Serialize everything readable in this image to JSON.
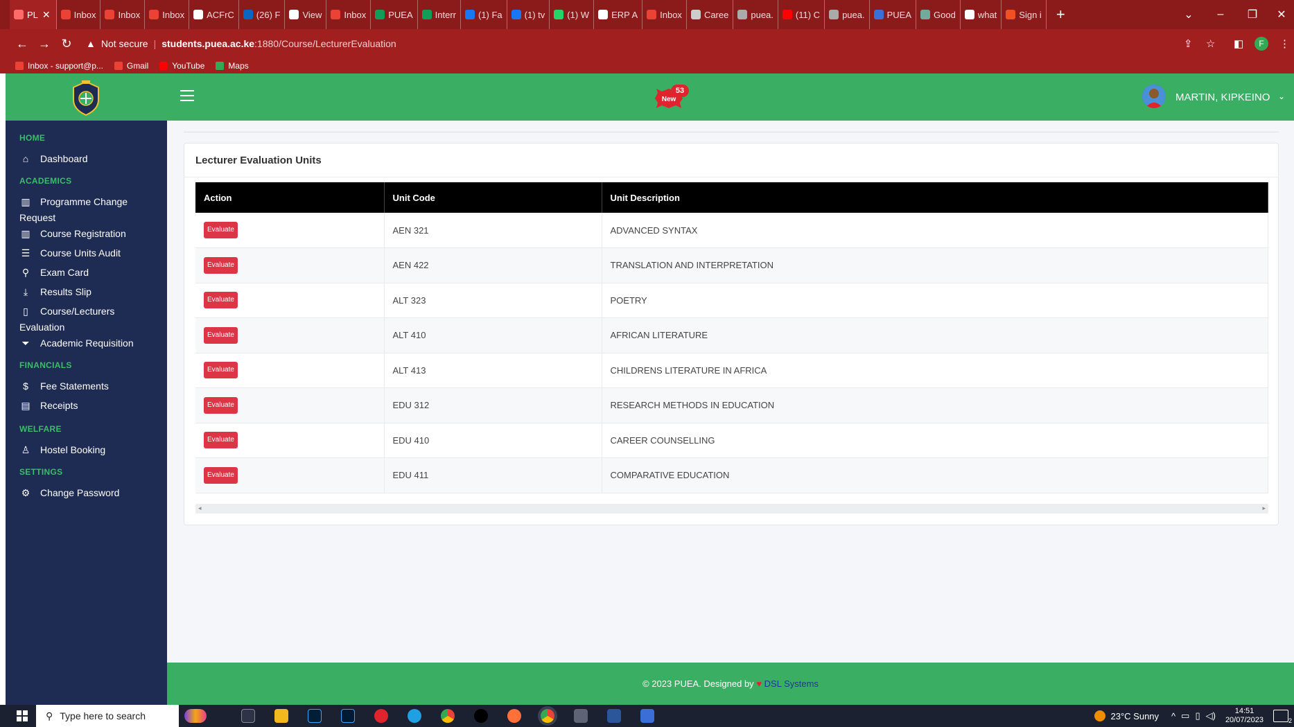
{
  "browser": {
    "tabs": [
      {
        "label": "PL",
        "color": "#ff6b6b",
        "active": true
      },
      {
        "label": "Inbox",
        "color": "#ea4335"
      },
      {
        "label": "Inbox",
        "color": "#ea4335"
      },
      {
        "label": "Inbox",
        "color": "#ea4335"
      },
      {
        "label": "ACFrC",
        "color": "#ffffff"
      },
      {
        "label": "(26) F",
        "color": "#0a66c2"
      },
      {
        "label": "View",
        "color": "#ffffff"
      },
      {
        "label": "Inbox",
        "color": "#ea4335"
      },
      {
        "label": "PUEA",
        "color": "#0f9d58"
      },
      {
        "label": "Interr",
        "color": "#0f9d58"
      },
      {
        "label": "(1) Fa",
        "color": "#1877f2"
      },
      {
        "label": "(1) tv",
        "color": "#1877f2"
      },
      {
        "label": "(1) W",
        "color": "#25d366"
      },
      {
        "label": "ERP A",
        "color": "#ffffff"
      },
      {
        "label": "Inbox",
        "color": "#ea4335"
      },
      {
        "label": "Caree",
        "color": "#cccccc"
      },
      {
        "label": "puea.",
        "color": "#aaaaaa"
      },
      {
        "label": "(11) C",
        "color": "#ff0000"
      },
      {
        "label": "puea.",
        "color": "#aaaaaa"
      },
      {
        "label": "PUEA",
        "color": "#3a6fd8"
      },
      {
        "label": "Good",
        "color": "#74aa9c"
      },
      {
        "label": "what",
        "color": "#ffffff"
      },
      {
        "label": "Sign i",
        "color": "#f25022"
      }
    ],
    "security": "Not secure",
    "url_host": "students.puea.ac.ke",
    "url_path": ":1880/Course/LecturerEvaluation",
    "profile_initial": "F",
    "bookmarks": [
      {
        "label": "Inbox - support@p...",
        "color": "#ea4335"
      },
      {
        "label": "Gmail",
        "color": "#ea4335"
      },
      {
        "label": "YouTube",
        "color": "#ff0000"
      },
      {
        "label": "Maps",
        "color": "#34a853"
      }
    ]
  },
  "header": {
    "notification_count": "53",
    "notification_badge": "New",
    "user_name": "MARTIN, KIPKEINO"
  },
  "sidebar": {
    "sections": [
      {
        "heading": "HOME",
        "items": [
          {
            "icon": "home-icon",
            "glyph": "⌂",
            "label": "Dashboard"
          }
        ]
      },
      {
        "heading": "ACADEMICS",
        "items": [
          {
            "icon": "columns-icon",
            "glyph": "▥",
            "label": "Programme Change Request"
          },
          {
            "icon": "columns-icon",
            "glyph": "▥",
            "label": "Course Registration"
          },
          {
            "icon": "list-icon",
            "glyph": "☰",
            "label": "Course Units Audit"
          },
          {
            "icon": "card-icon",
            "glyph": "⚲",
            "label": "Exam Card"
          },
          {
            "icon": "download-icon",
            "glyph": "⤓",
            "label": "Results Slip"
          },
          {
            "icon": "clipboard-icon",
            "glyph": "▯",
            "label": "Course/Lecturers Evaluation"
          },
          {
            "icon": "filter-icon",
            "glyph": "⏷",
            "label": "Academic Requisition"
          }
        ]
      },
      {
        "heading": "FINANCIALS",
        "items": [
          {
            "icon": "dollar-icon",
            "glyph": "$",
            "label": "Fee Statements"
          },
          {
            "icon": "receipt-icon",
            "glyph": "▤",
            "label": "Receipts"
          }
        ]
      },
      {
        "heading": "WELFARE",
        "items": [
          {
            "icon": "user-icon",
            "glyph": "♙",
            "label": "Hostel Booking"
          }
        ]
      },
      {
        "heading": "SETTINGS",
        "items": [
          {
            "icon": "gear-icon",
            "glyph": "⚙",
            "label": "Change Password"
          }
        ]
      }
    ]
  },
  "main": {
    "card_title": "Lecturer Evaluation Units",
    "columns": [
      "Action",
      "Unit Code",
      "Unit Description"
    ],
    "action_label": "Evaluate",
    "rows": [
      {
        "code": "AEN 321",
        "description": "ADVANCED SYNTAX"
      },
      {
        "code": "AEN 422",
        "description": "TRANSLATION AND INTERPRETATION"
      },
      {
        "code": "ALT 323",
        "description": "POETRY"
      },
      {
        "code": "ALT 410",
        "description": "AFRICAN LITERATURE"
      },
      {
        "code": "ALT 413",
        "description": "CHILDRENS LITERATURE IN AFRICA"
      },
      {
        "code": "EDU 312",
        "description": "RESEARCH METHODS IN EDUCATION"
      },
      {
        "code": "EDU 410",
        "description": "CAREER COUNSELLING"
      },
      {
        "code": "EDU 411",
        "description": "COMPARATIVE EDUCATION"
      }
    ]
  },
  "footer": {
    "text": "© 2023 PUEA. Designed by",
    "heart": "♥",
    "brand": "DSL Systems"
  },
  "taskbar": {
    "search_placeholder": "Type here to search",
    "weather": "23°C  Sunny",
    "time": "14:51",
    "date": "20/07/2023",
    "notification_count": "2"
  },
  "colors": {
    "brand_green": "#3aaf63",
    "sidebar_navy": "#1e2b52",
    "browser_red": "#a11f1f",
    "danger": "#dc3545"
  }
}
